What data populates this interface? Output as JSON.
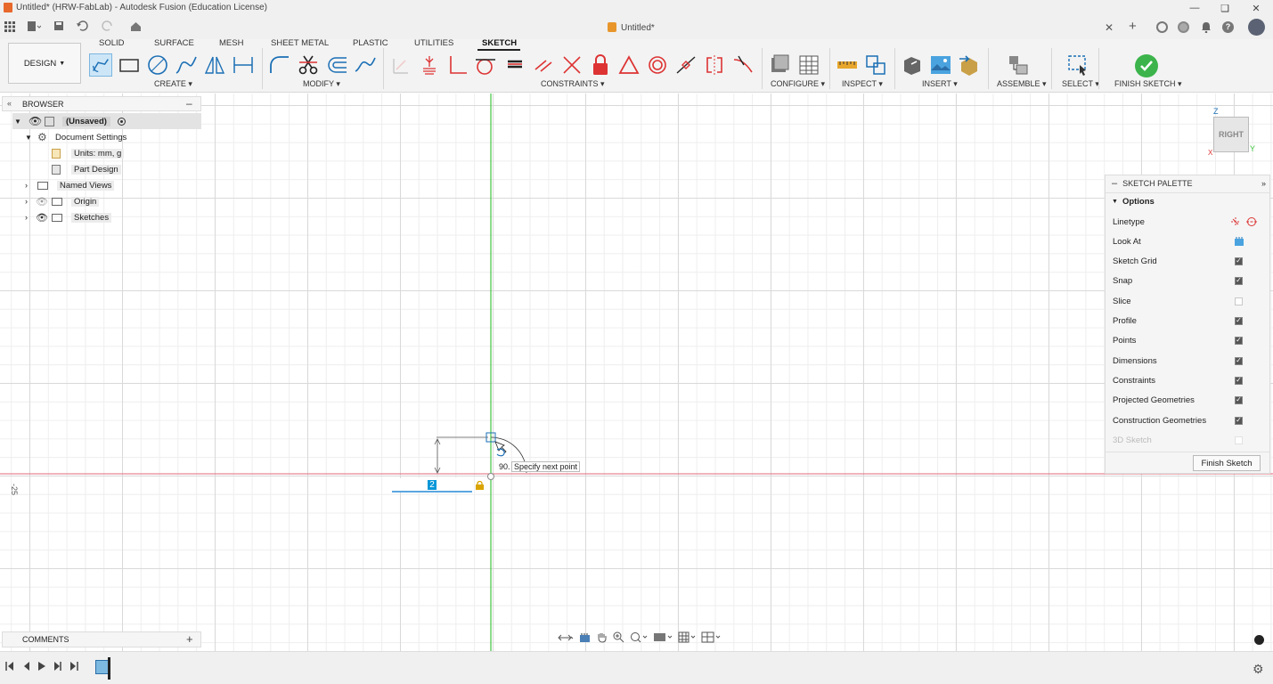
{
  "window": {
    "title": "Untitled* (HRW-FabLab) - Autodesk Fusion (Education License)"
  },
  "doc_tab": {
    "label": "Untitled*"
  },
  "workspace": {
    "label": "DESIGN"
  },
  "ribbon_tabs": [
    "SOLID",
    "SURFACE",
    "MESH",
    "SHEET METAL",
    "PLASTIC",
    "UTILITIES",
    "SKETCH"
  ],
  "groups": {
    "create": "CREATE",
    "modify": "MODIFY",
    "constraints": "CONSTRAINTS",
    "configure": "CONFIGURE",
    "inspect": "INSPECT",
    "insert": "INSERT",
    "assemble": "ASSEMBLE",
    "select": "SELECT",
    "finish": "FINISH SKETCH"
  },
  "browser": {
    "title": "BROWSER",
    "root": "(Unsaved)",
    "doc_settings": "Document Settings",
    "units": "Units: mm, g",
    "part_design": "Part Design",
    "named_views": "Named Views",
    "origin": "Origin",
    "sketches": "Sketches"
  },
  "viewcube": {
    "face": "RIGHT",
    "axis_z": "Z",
    "axis_y": "Y",
    "axis_x": "X"
  },
  "palette": {
    "title": "SKETCH PALETTE",
    "section": "Options",
    "rows": [
      {
        "label": "Linetype"
      },
      {
        "label": "Look At"
      },
      {
        "label": "Sketch Grid",
        "checked": true
      },
      {
        "label": "Snap",
        "checked": true
      },
      {
        "label": "Slice",
        "checked": false
      },
      {
        "label": "Profile",
        "checked": true
      },
      {
        "label": "Points",
        "checked": true
      },
      {
        "label": "Dimensions",
        "checked": true
      },
      {
        "label": "Constraints",
        "checked": true
      },
      {
        "label": "Projected Geometries",
        "checked": true
      },
      {
        "label": "Construction Geometries",
        "checked": true
      },
      {
        "label": "3D Sketch",
        "checked": false,
        "disabled": true
      }
    ],
    "finish_button": "Finish Sketch"
  },
  "canvas": {
    "tooltip": "Specify next point",
    "angle_label": "90.",
    "dimension_input": "2",
    "ruler_label": "-25"
  },
  "comments": {
    "label": "COMMENTS"
  },
  "colors": {
    "accent": "#0696d7",
    "green_axis": "#3fc43f",
    "red_axis": "#e26a7a",
    "finish_green": "#3cb44b"
  }
}
